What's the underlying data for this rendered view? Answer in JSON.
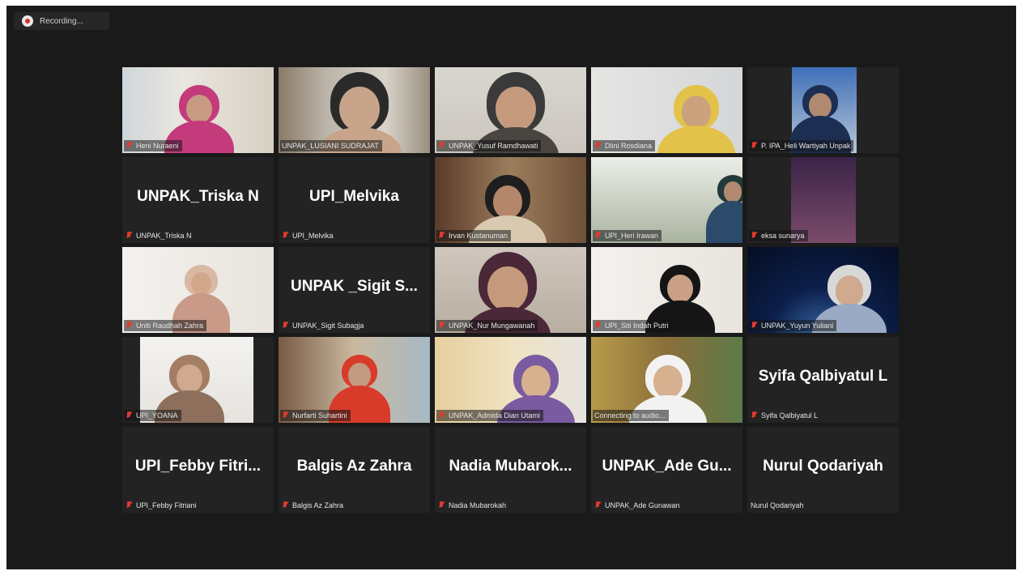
{
  "recording": {
    "label": "Recording..."
  },
  "participants": [
    {
      "name": "Heni Nuraeni",
      "muted": true
    },
    {
      "name": "UNPAK_LUSIANI SUDRAJAT",
      "muted": false
    },
    {
      "name": "UNPAK_Yusuf Ramdhawati",
      "muted": true
    },
    {
      "name": "Diini Rosdiana",
      "muted": true
    },
    {
      "name": "P. IPA_Heli Wartiyah Unpak",
      "muted": true
    },
    {
      "name": "UNPAK_Triska N",
      "display": "UNPAK_Triska N",
      "muted": true
    },
    {
      "name": "UPI_Melvika",
      "display": "UPI_Melvika",
      "muted": true
    },
    {
      "name": "Irvan Kustanuman",
      "muted": true
    },
    {
      "name": "UPI_Heri Irawan",
      "muted": true
    },
    {
      "name": "eksa sunarya",
      "muted": true
    },
    {
      "name": "Uniti Raudhah Zahra",
      "muted": true
    },
    {
      "name": "UNPAK_Sigit Subagja",
      "display": "UNPAK _Sigit S...",
      "muted": true
    },
    {
      "name": "UNPAK_Nur Mungawanah",
      "muted": true
    },
    {
      "name": "UPI_Siti Indah Putri",
      "muted": true
    },
    {
      "name": "UNPAK_Yuyun Yuliani",
      "muted": true
    },
    {
      "name": "UPI_YOANA",
      "muted": true
    },
    {
      "name": "Nurfarti Suhartini",
      "muted": true
    },
    {
      "name": "UNPAK_Admida Dian Utami",
      "muted": true
    },
    {
      "name": "Connecting to audio...",
      "muted": false
    },
    {
      "name": "Syifa Qalbiyatul L",
      "display": "Syifa Qalbiyatul L",
      "muted": true
    },
    {
      "name": "UPI_Febby Fitriani",
      "display": "UPI_Febby  Fitri...",
      "muted": true
    },
    {
      "name": "Balgis Az Zahra",
      "display": "Balgis Az Zahra",
      "muted": true
    },
    {
      "name": "Nadia Mubarokah",
      "display": "Nadia  Mubarok...",
      "muted": true
    },
    {
      "name": "UNPAK_Ade Gunawan",
      "display": "UNPAK_Ade  Gu...",
      "muted": true
    },
    {
      "name": "Nurul Qodariyah",
      "display": "Nurul Qodariyah",
      "muted": false
    }
  ]
}
